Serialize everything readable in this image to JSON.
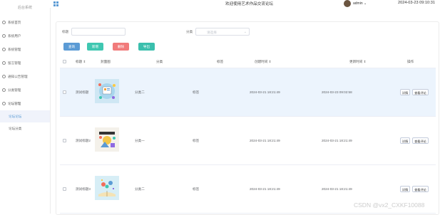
{
  "sidebar": {
    "title": "后台系统",
    "items": [
      {
        "label": "系统首页",
        "icon": "home-icon"
      },
      {
        "label": "系统用户",
        "icon": "user-icon"
      },
      {
        "label": "系统管理",
        "icon": "settings-icon"
      },
      {
        "label": "留言管理",
        "icon": "message-icon"
      },
      {
        "label": "通知公告管理",
        "icon": "notice-icon"
      },
      {
        "label": "分类管理",
        "icon": "category-icon"
      },
      {
        "label": "论坛管理",
        "icon": "forum-icon"
      }
    ],
    "subitems": [
      {
        "label": "论坛论坛"
      },
      {
        "label": "论坛分类"
      }
    ]
  },
  "header": {
    "title": "欢迎使用艺术作品交流论坛",
    "user": "admin",
    "time": "2024-03-23 09:10:31"
  },
  "search": {
    "title_label": "标题",
    "title_value": "",
    "category_label": "分类",
    "category_placeholder": "请选择"
  },
  "buttons": {
    "search": "查询",
    "add": "新增",
    "delete": "删除",
    "export": "导出"
  },
  "table": {
    "columns": [
      "标题",
      "封面图",
      "分类",
      "标签",
      "创建时间",
      "更新时间",
      "操作"
    ],
    "rows": [
      {
        "title": "测试标题",
        "category": "分类二",
        "tag": "标签",
        "created": "2024-03-21 18:21:49",
        "updated": "2024-03-23 09:02:58",
        "thumb": "thumb-1"
      },
      {
        "title": "测试标题2",
        "category": "分类一",
        "tag": "标签",
        "created": "2024-03-21 18:21:49",
        "updated": "2024-03-21 18:21:49",
        "thumb": "thumb-2"
      },
      {
        "title": "测试标题3",
        "category": "分类二",
        "tag": "标签",
        "created": "2024-03-21 18:21:49",
        "updated": "2024-03-21 18:21:49",
        "thumb": "thumb-3"
      }
    ],
    "action_detail": "详情",
    "action_comment": "查看评论"
  },
  "watermark": "CSDN @vx2_CXKF10088",
  "colors": {
    "primary": "#5b9bd5",
    "success": "#3fc7b1",
    "danger": "#f17b7b",
    "teal": "#3bbfad"
  }
}
